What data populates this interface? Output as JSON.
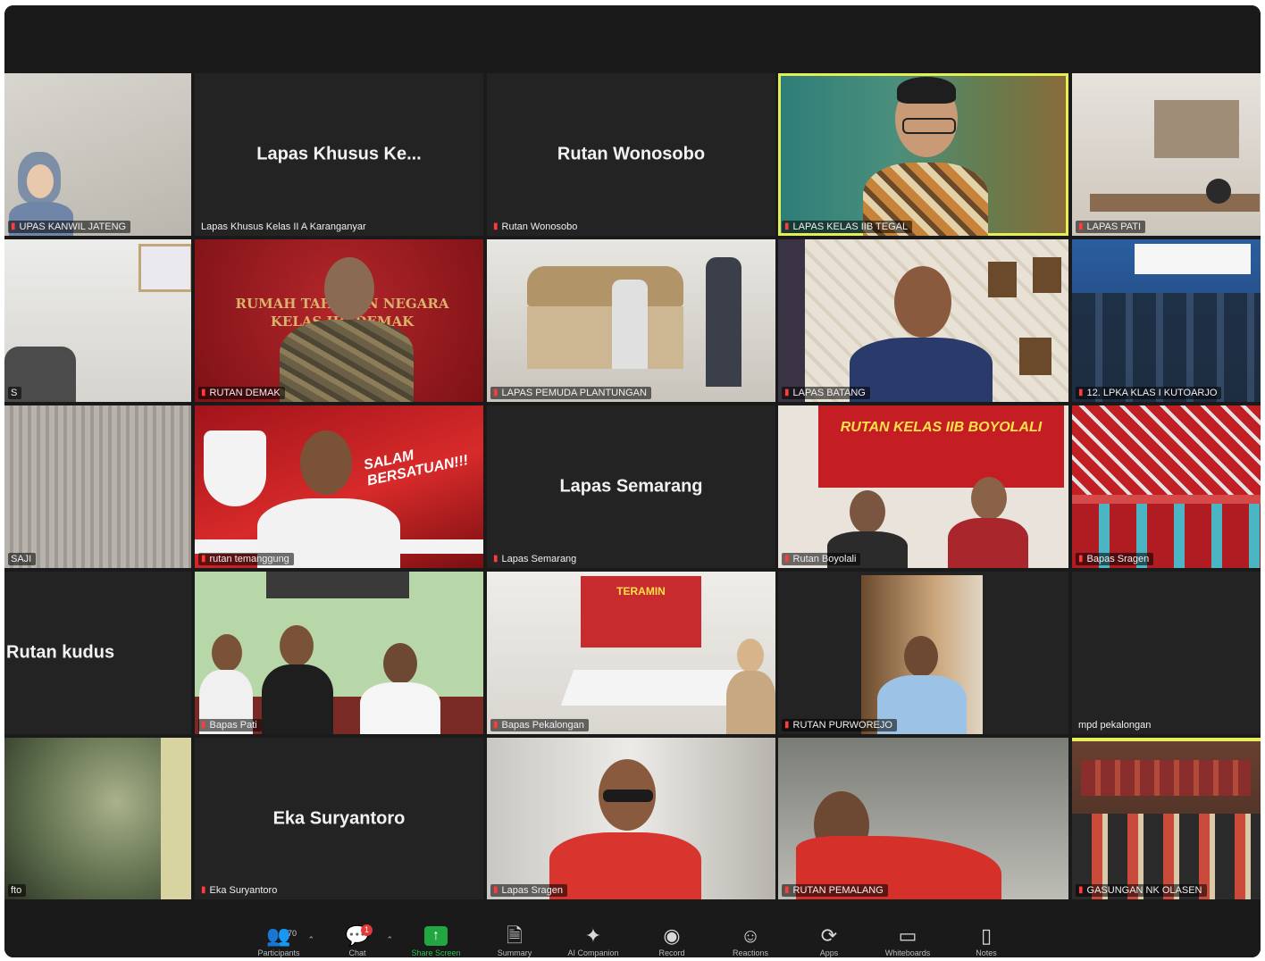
{
  "tiles": {
    "r1c1": {
      "label": "UPAS KANWIL JATENG"
    },
    "r1c2": {
      "name": "Lapas Khusus Ke...",
      "label": "Lapas Khusus Kelas II A Karanganyar"
    },
    "r1c3": {
      "name": "Rutan Wonosobo",
      "label": "Rutan Wonosobo"
    },
    "r1c4": {
      "label": "LAPAS KELAS IIB TEGAL"
    },
    "r1c5": {
      "label": "LAPAS PATI"
    },
    "r2c1": {
      "label": "S"
    },
    "r2c2": {
      "label": "RUTAN DEMAK",
      "sign": "RUMAH TAHANAN NEGARA KELAS IIB DEMAK"
    },
    "r2c3": {
      "label": "LAPAS PEMUDA PLANTUNGAN"
    },
    "r2c4": {
      "label": "LAPAS BATANG"
    },
    "r2c5": {
      "label": "12. LPKA KLAS I KUTOARJO"
    },
    "r3c1": {
      "label": "SAJI"
    },
    "r3c2": {
      "label": "rutan temanggung",
      "banner": "SALAM BERSATUAN!!!"
    },
    "r3c3": {
      "name": "Lapas Semarang",
      "label": "Lapas Semarang"
    },
    "r3c4": {
      "label": "Rutan Boyolali",
      "banner": "RUTAN KELAS IIB BOYOLALI"
    },
    "r3c5": {
      "label": "Bapas Sragen"
    },
    "r4c1": {
      "name": "Rutan kudus"
    },
    "r4c2": {
      "label": "Bapas Pati"
    },
    "r4c3": {
      "label": "Bapas Pekalongan",
      "banner": "TERAMIN"
    },
    "r4c4": {
      "label": "RUTAN PURWOREJO"
    },
    "r4c5": {
      "label": "mpd pekalongan"
    },
    "r5c1": {
      "label": "fto"
    },
    "r5c2": {
      "name": "Eka Suryantoro",
      "label": "Eka Suryantoro"
    },
    "r5c3": {
      "label": "Lapas Sragen"
    },
    "r5c4": {
      "label": "RUTAN PEMALANG"
    },
    "r5c5": {
      "label": "GASUNGAN NK OLASEN"
    }
  },
  "toolbar": {
    "participants": {
      "label": "Participants",
      "count": "70"
    },
    "chat": {
      "label": "Chat",
      "badge": "1"
    },
    "share": {
      "label": "Share Screen"
    },
    "summary": {
      "label": "Summary"
    },
    "ai": {
      "label": "AI Companion"
    },
    "record": {
      "label": "Record"
    },
    "reactions": {
      "label": "Reactions"
    },
    "apps": {
      "label": "Apps"
    },
    "whiteboards": {
      "label": "Whiteboards"
    },
    "notes": {
      "label": "Notes"
    }
  },
  "colors": {
    "active_border": "#e4ee56",
    "share_green": "#21a642",
    "mic_red": "#ff3b3b"
  }
}
